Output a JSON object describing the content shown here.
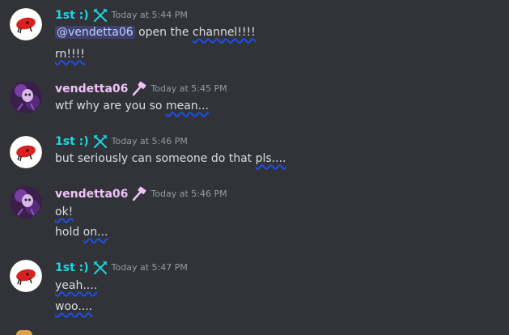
{
  "colors": {
    "background": "#313338",
    "user_1st": "#1ed5e0",
    "user_vendetta": "#f0c3f8",
    "timestamp": "#949ba4",
    "text": "#dbdee1",
    "spellcheck": "#1e4ee8"
  },
  "groups": [
    {
      "username": "1st :)",
      "role_icon": "crossed-swords-icon",
      "timestamp": "Today at 5:44 PM",
      "lines": [
        {
          "mention": "@vendetta06",
          "text": " open the ",
          "misspelled": "channel!!!!"
        },
        {
          "text": "",
          "misspelled": "rn!!!!"
        }
      ]
    },
    {
      "username": "vendetta06",
      "role_icon": "hammer-icon",
      "timestamp": "Today at 5:45 PM",
      "lines": [
        {
          "text": "wtf why are you so ",
          "misspelled": "mean..."
        }
      ]
    },
    {
      "username": "1st :)",
      "role_icon": "crossed-swords-icon",
      "timestamp": "Today at 5:46 PM",
      "lines": [
        {
          "text": "but seriously can someone do that ",
          "misspelled": "pls...."
        }
      ]
    },
    {
      "username": "vendetta06",
      "role_icon": "hammer-icon",
      "timestamp": "Today at 5:46 PM",
      "lines": [
        {
          "text": "",
          "misspelled": "ok!"
        },
        {
          "text": "hold ",
          "misspelled": "on..."
        }
      ]
    },
    {
      "username": "1st :)",
      "role_icon": "crossed-swords-icon",
      "timestamp": "Today at 5:47 PM",
      "lines": [
        {
          "text": "",
          "misspelled": "yeah...."
        },
        {
          "text": "",
          "misspelled": "woo...."
        }
      ]
    }
  ]
}
